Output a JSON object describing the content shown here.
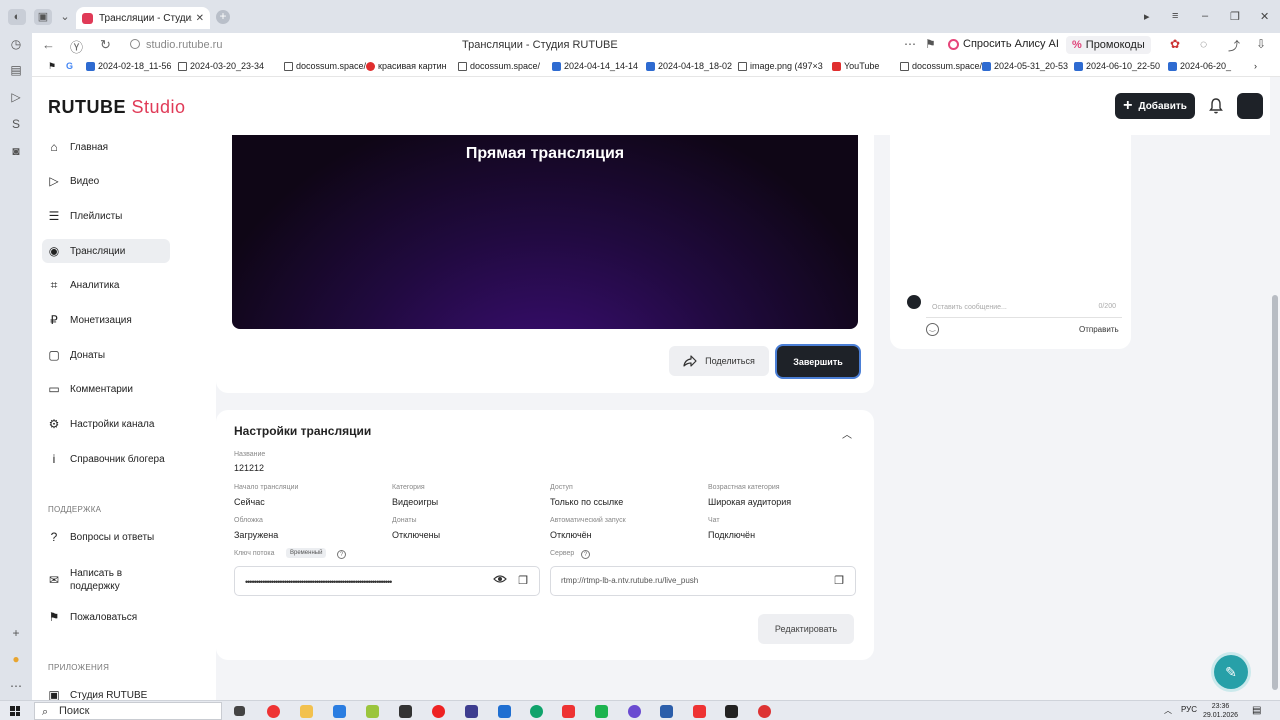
{
  "browser": {
    "tab_title": "Трансляции - Студия R",
    "url": "studio.rutube.ru",
    "page_title": "Трансляции - Студия RUTUBE",
    "alisa_label": "Спросить Алису AI",
    "promo_label": "Промокоды",
    "bookmarks": [
      {
        "label": "2024-02-18_11-56",
        "icon": "image-icon"
      },
      {
        "label": "2024-03-20_23-34",
        "icon": "doc-icon"
      },
      {
        "label": "docossum.space/",
        "icon": "doc-icon"
      },
      {
        "label": "красивая картин",
        "icon": "opera-icon"
      },
      {
        "label": "docossum.space/",
        "icon": "doc-icon"
      },
      {
        "label": "2024-04-14_14-14",
        "icon": "image-icon"
      },
      {
        "label": "2024-04-18_18-02",
        "icon": "image-icon"
      },
      {
        "label": "image.png (497×3",
        "icon": "doc-icon"
      },
      {
        "label": "YouTube",
        "icon": "youtube-icon"
      },
      {
        "label": "docossum.space/",
        "icon": "doc-icon"
      },
      {
        "label": "2024-05-31_20-53",
        "icon": "image-icon"
      },
      {
        "label": "2024-06-10_22-50",
        "icon": "image-icon"
      },
      {
        "label": "2024-06-20_",
        "icon": "image-icon"
      }
    ]
  },
  "header": {
    "logo_main": "RUTUBE",
    "logo_sub": "Studio",
    "add_button": "Добавить"
  },
  "sidebar": {
    "items": [
      {
        "label": "Главная",
        "icon": "home-icon"
      },
      {
        "label": "Видео",
        "icon": "video-icon"
      },
      {
        "label": "Плейлисты",
        "icon": "playlist-icon"
      },
      {
        "label": "Трансляции",
        "icon": "broadcast-icon",
        "active": true
      },
      {
        "label": "Аналитика",
        "icon": "analytics-icon"
      },
      {
        "label": "Монетизация",
        "icon": "ruble-icon"
      },
      {
        "label": "Донаты",
        "icon": "donate-icon"
      },
      {
        "label": "Комментарии",
        "icon": "comments-icon"
      },
      {
        "label": "Настройки канала",
        "icon": "gear-icon"
      },
      {
        "label": "Справочник блогера",
        "icon": "info-icon"
      }
    ],
    "support_heading": "ПОДДЕРЖКА",
    "support_items": [
      {
        "label": "Вопросы и ответы",
        "icon": "question-icon"
      },
      {
        "label": "Написать в поддержку",
        "icon": "mail-icon"
      },
      {
        "label": "Пожаловаться",
        "icon": "flag-icon"
      }
    ],
    "apps_heading": "ПРИЛОЖЕНИЯ",
    "apps_item": "Студия RUTUBE"
  },
  "player": {
    "live_title": "Прямая трансляция",
    "share_label": "Поделиться",
    "finish_label": "Завершить"
  },
  "settings": {
    "title": "Настройки трансляции",
    "name_label": "Название",
    "name_value": "121212",
    "fields": [
      {
        "label": "Начало трансляции",
        "value": "Сейчас"
      },
      {
        "label": "Категория",
        "value": "Видеоигры"
      },
      {
        "label": "Доступ",
        "value": "Только по ссылке"
      },
      {
        "label": "Возрастная категория",
        "value": "Широкая аудитория"
      },
      {
        "label": "Обложка",
        "value": "Загружена"
      },
      {
        "label": "Донаты",
        "value": "Отключены"
      },
      {
        "label": "Автоматический запуск",
        "value": "Отключён"
      },
      {
        "label": "Чат",
        "value": "Подключён"
      }
    ],
    "key_label": "Ключ потока",
    "key_badge": "Временный",
    "key_value": "••••••••••••••••••••••••••••••••••••••••••••••••••••••••••••••••••••",
    "server_label": "Сервер",
    "server_value": "rtmp://rtmp-lb-a.ntv.rutube.ru/live_push",
    "edit_label": "Редактировать"
  },
  "chat": {
    "placeholder": "Оставить сообщение...",
    "counter": "0/200",
    "send_label": "Отправить"
  },
  "taskbar": {
    "search_placeholder": "Поиск",
    "lang": "РУС",
    "time": "23:36",
    "date": "29.01.2026"
  }
}
